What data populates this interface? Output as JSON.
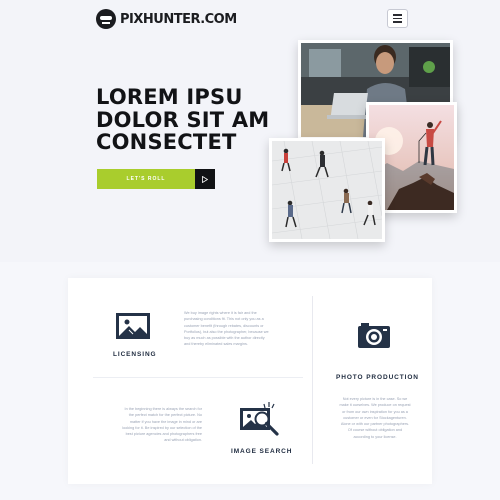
{
  "header": {
    "logo_text": "PIXHUNTER.COM",
    "menu_icon": "hamburger-menu-icon"
  },
  "hero": {
    "headline_lines": [
      "LOREM IPSU",
      "DOLOR SIT AM",
      "CONSECTET"
    ],
    "cta_label": "LET'S ROLL",
    "cta_icon": "play-arrow-icon",
    "accent_color": "#a9cd2d",
    "photos": [
      "man-with-laptop-photo",
      "hiker-on-peak-photo",
      "people-walking-photo"
    ]
  },
  "services": {
    "licensing": {
      "title": "LICENSING",
      "icon": "image-frame-icon",
      "text_lines": [
        "We buy image rights where it is fair and the",
        "purchasing conditions fit. This not only you as a",
        "customer benefit (through rebates, discounts or",
        "Portfolios), but also the photographer, because we",
        "buy as much as possible with the author directly",
        "and thereby eliminated sales margins."
      ]
    },
    "photo_production": {
      "title": "PHOTO PRODUCTION",
      "icon": "camera-icon",
      "text_lines": [
        "Not every picture is in the case. So we",
        "make it ourselves. We produce on request",
        "or from our own inspiration for you as a",
        "customer or even for Stockagenturen.",
        "Alone or with our partner photographers.",
        "Of course without obligation and",
        "according to your license."
      ]
    },
    "image_search": {
      "title": "IMAGE SEARCH",
      "icon": "magnifier-search-icon",
      "text_lines": [
        "In the beginning there is always the search for",
        "the perfect match for the perfect picture. No",
        "matter if you have the image in mind or are",
        "looking for it. Be inspired by our selection of the",
        "best picture agencies and photographers free",
        "and without obligation."
      ]
    }
  }
}
